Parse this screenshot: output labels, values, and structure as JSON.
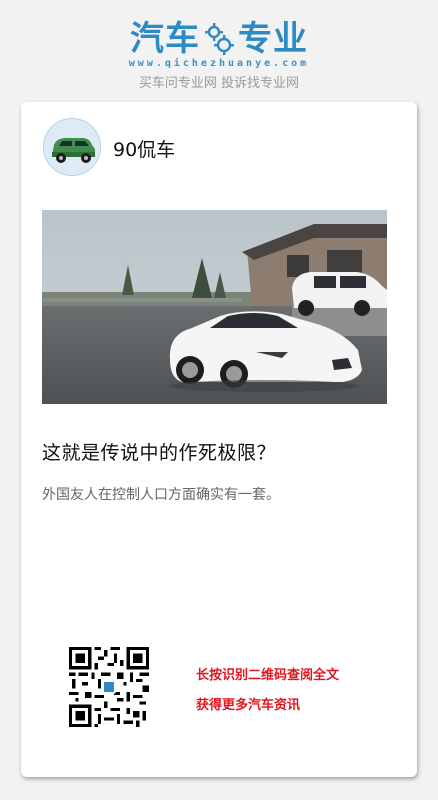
{
  "brand": {
    "name_left": "汽车",
    "name_right": "专业",
    "url": "www.qichezhuanye.com",
    "slogan": "买车问专业网 投诉找专业网",
    "accent_color": "#2d8ac4"
  },
  "author": {
    "name": "90侃车",
    "avatar_icon": "green-car-icon"
  },
  "article": {
    "title": "这就是传说中的作死极限？",
    "description": "外国友人在控制人口方面确实有一套。"
  },
  "footer": {
    "qr_icon": "qr-code-icon",
    "cta_line1": "长按识别二维码查阅全文",
    "cta_line2": "获得更多汽车资讯",
    "cta_color": "#e0161f"
  }
}
